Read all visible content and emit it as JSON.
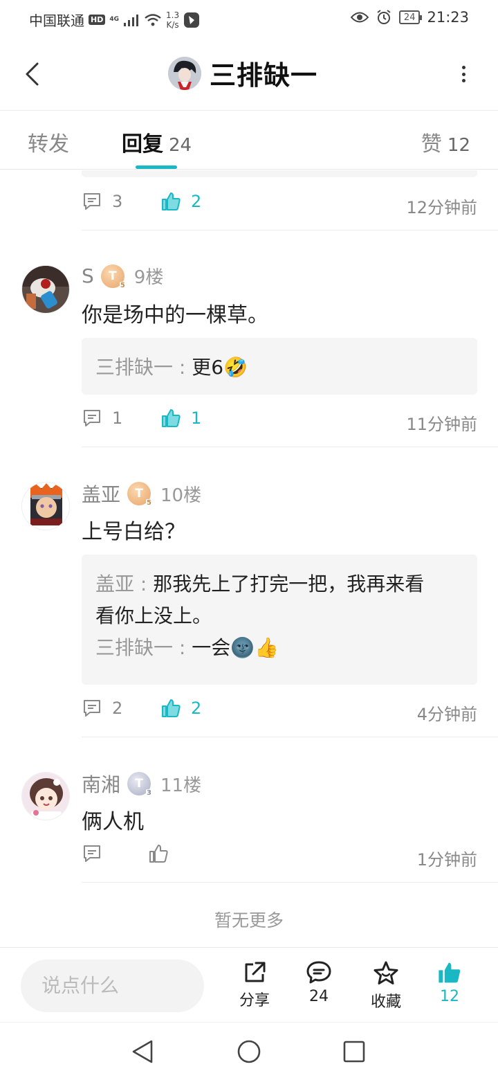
{
  "status_bar": {
    "carrier": "中国联通",
    "hd": "HD",
    "net": "4G",
    "speed_value": "1.3",
    "speed_unit": "K/s",
    "battery": "24",
    "time": "21:23"
  },
  "header": {
    "title": "三排缺一"
  },
  "tabs": {
    "forward_label": "转发",
    "reply_label": "回复",
    "reply_count": "24",
    "like_label": "赞",
    "like_count": "12"
  },
  "prev_post": {
    "comment_count": "3",
    "like_count": "2",
    "time": "12分钟前"
  },
  "posts": [
    {
      "username": "S",
      "badge": "T",
      "badge_level": "5",
      "floor": "9楼",
      "content": "你是场中的一棵草。",
      "replies": [
        {
          "name": "三排缺一",
          "sep": " : ",
          "text": "更6🤣"
        }
      ],
      "comment_count": "1",
      "like_count": "1",
      "time": "11分钟前"
    },
    {
      "username": "盖亚",
      "badge": "T",
      "badge_level": "5",
      "floor": "10楼",
      "content": "上号白给？",
      "replies": [
        {
          "name": "盖亚",
          "sep": " : ",
          "text": "那我先上了打完一把，我再来看看你上没上。"
        },
        {
          "name": "三排缺一",
          "sep": " : ",
          "text": "一会🌚👍"
        }
      ],
      "comment_count": "2",
      "like_count": "2",
      "time": "4分钟前"
    },
    {
      "username": "南湘",
      "badge": "T",
      "badge_level": "3",
      "floor": "11楼",
      "content": "俩人机",
      "comment_count": "",
      "like_count": "",
      "time": "1分钟前"
    }
  ],
  "no_more": "暂无更多",
  "bottom_bar": {
    "placeholder": "说点什么",
    "share_label": "分享",
    "comment_count": "24",
    "favorite_label": "收藏",
    "like_count": "12"
  },
  "colors": {
    "accent": "#1ab8c4",
    "muted": "#888888",
    "quote_bg": "#f5f5f5"
  }
}
